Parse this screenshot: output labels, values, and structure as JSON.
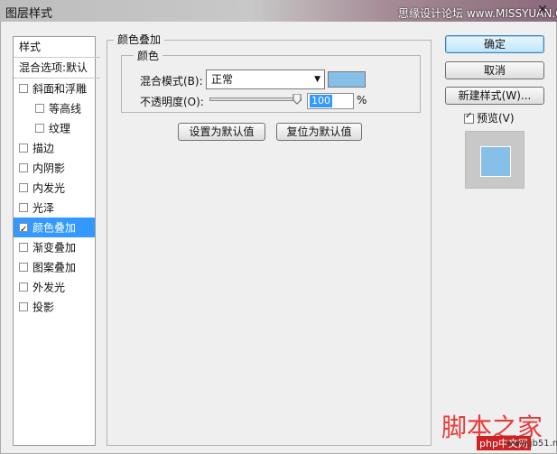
{
  "window": {
    "title": "图层样式",
    "close_glyph": "✕"
  },
  "watermark": {
    "top": "思缘设计论坛 www.MISSYUAN.COM",
    "logo": "脚本之家",
    "url_left": "php中文网",
    "url_right": "www.jb51.net"
  },
  "style_list": {
    "header": "样式",
    "blend_options": "混合选项:默认",
    "items": [
      {
        "label": "斜面和浮雕",
        "checked": false,
        "sub": false
      },
      {
        "label": "等高线",
        "checked": false,
        "sub": true
      },
      {
        "label": "纹理",
        "checked": false,
        "sub": true
      },
      {
        "label": "描边",
        "checked": false,
        "sub": false
      },
      {
        "label": "内阴影",
        "checked": false,
        "sub": false
      },
      {
        "label": "内发光",
        "checked": false,
        "sub": false
      },
      {
        "label": "光泽",
        "checked": false,
        "sub": false
      },
      {
        "label": "颜色叠加",
        "checked": true,
        "sub": false,
        "selected": true
      },
      {
        "label": "渐变叠加",
        "checked": false,
        "sub": false
      },
      {
        "label": "图案叠加",
        "checked": false,
        "sub": false
      },
      {
        "label": "外发光",
        "checked": false,
        "sub": false
      },
      {
        "label": "投影",
        "checked": false,
        "sub": false
      }
    ]
  },
  "panel": {
    "group_title": "颜色叠加",
    "subgroup_title": "颜色",
    "blend_mode_label": "混合模式(B):",
    "blend_mode_value": "正常",
    "overlay_color": "#86c0e8",
    "opacity_label": "不透明度(O):",
    "opacity_value": "100",
    "opacity_unit": "%",
    "set_default": "设置为默认值",
    "reset_default": "复位为默认值"
  },
  "actions": {
    "ok": "确定",
    "cancel": "取消",
    "new_style": "新建样式(W)...",
    "preview_label": "预览(V)",
    "preview_checked": true
  },
  "colors": {
    "selected_bg": "#3399ff",
    "swatch": "#86c0e8"
  }
}
